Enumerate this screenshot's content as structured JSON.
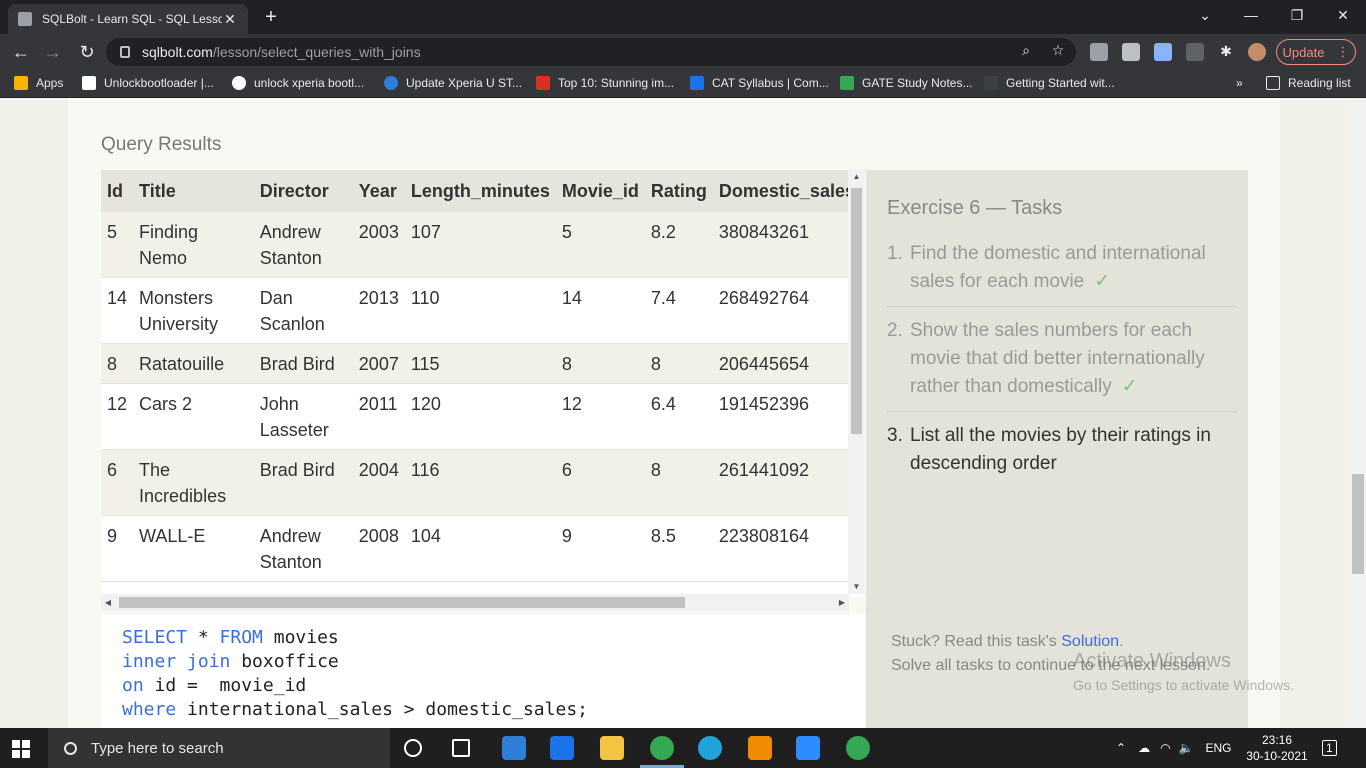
{
  "browser": {
    "tab_title": "SQLBolt - Learn SQL - SQL Lessor",
    "url_host": "sqlbolt.com",
    "url_path": "/lesson/select_queries_with_joins",
    "update_label": "Update",
    "bookmarks": [
      {
        "label": "Apps",
        "icon": "apps-grid-icon",
        "color": "#f4b400"
      },
      {
        "label": "Unlockbootloader |...",
        "icon": "s-logo-icon",
        "color": "#ffffff"
      },
      {
        "label": "unlock xperia bootl...",
        "icon": "globe-icon",
        "color": "#ffffff"
      },
      {
        "label": "Update Xperia U ST...",
        "icon": "e-logo-icon",
        "color": "#2f7ed8"
      },
      {
        "label": "Top 10: Stunning im...",
        "icon": "ibn-logo-icon",
        "color": "#d93025"
      },
      {
        "label": "CAT Syllabus | Com...",
        "icon": "c-logo-icon",
        "color": "#1a73e8"
      },
      {
        "label": "GATE Study Notes...",
        "icon": "leaf-icon",
        "color": "#34a853"
      },
      {
        "label": "Getting Started wit...",
        "icon": "page-icon",
        "color": "#3c4043"
      }
    ],
    "reading_list_label": "Reading list",
    "more_bookmarks": "»"
  },
  "page": {
    "query_results_title": "Query Results",
    "table": {
      "columns": [
        "Id",
        "Title",
        "Director",
        "Year",
        "Length_minutes",
        "Movie_id",
        "Rating",
        "Domestic_sales"
      ],
      "rows": [
        [
          "5",
          "Finding Nemo",
          "Andrew Stanton",
          "2003",
          "107",
          "5",
          "8.2",
          "380843261"
        ],
        [
          "14",
          "Monsters University",
          "Dan Scanlon",
          "2013",
          "110",
          "14",
          "7.4",
          "268492764"
        ],
        [
          "8",
          "Ratatouille",
          "Brad Bird",
          "2007",
          "115",
          "8",
          "8",
          "206445654"
        ],
        [
          "12",
          "Cars 2",
          "John Lasseter",
          "2011",
          "120",
          "12",
          "6.4",
          "191452396"
        ],
        [
          "6",
          "The Incredibles",
          "Brad Bird",
          "2004",
          "116",
          "6",
          "8",
          "261441092"
        ],
        [
          "9",
          "WALL-E",
          "Andrew Stanton",
          "2008",
          "104",
          "9",
          "8.5",
          "223808164"
        ]
      ]
    },
    "query_lines": [
      [
        {
          "t": "SELECT",
          "k": true
        },
        {
          "t": " * ",
          "k": false
        },
        {
          "t": "FROM",
          "k": true
        },
        {
          "t": " movies",
          "k": false
        }
      ],
      [
        {
          "t": "inner join",
          "k": true
        },
        {
          "t": " boxoffice",
          "k": false
        }
      ],
      [
        {
          "t": "on",
          "k": true
        },
        {
          "t": " id =  movie_id",
          "k": false
        }
      ],
      [
        {
          "t": "where",
          "k": true
        },
        {
          "t": " international_sales > domestic_sales;",
          "k": false
        }
      ]
    ],
    "exercise": {
      "title": "Exercise 6 — Tasks",
      "tasks": [
        {
          "num": "1.",
          "text": "Find the domestic and international sales for each movie",
          "done": true
        },
        {
          "num": "2.",
          "text": "Show the sales numbers for each movie that did better internationally rather than domestically",
          "done": true
        },
        {
          "num": "3.",
          "text": "List all the movies by their ratings in descending order",
          "done": false
        }
      ],
      "check_mark": "✓",
      "stuck_prefix": "Stuck? Read this task's ",
      "solution_link": "Solution",
      "stuck_suffix": ".",
      "continue_text": "Solve all tasks to continue to the next lesson."
    },
    "watermark": {
      "line1": "Activate Windows",
      "line2": "Go to Settings to activate Windows."
    }
  },
  "taskbar": {
    "search_placeholder": "Type here to search",
    "language": "ENG",
    "time": "23:16",
    "date": "30-10-2021",
    "notification_count": "1",
    "apps": [
      {
        "name": "cortana-icon",
        "color": "#ffffff"
      },
      {
        "name": "task-view-icon",
        "color": "#ffffff"
      },
      {
        "name": "store-icon",
        "color": "#2f7ed8"
      },
      {
        "name": "mail-icon",
        "color": "#1a73e8"
      },
      {
        "name": "file-explorer-icon",
        "color": "#f4c542"
      },
      {
        "name": "chrome-icon",
        "color": "#34a853"
      },
      {
        "name": "edge-icon",
        "color": "#1fa3d8"
      },
      {
        "name": "vlc-icon",
        "color": "#f08a00"
      },
      {
        "name": "zoom-icon",
        "color": "#2d8cff"
      },
      {
        "name": "chrome-profile-icon",
        "color": "#34a853"
      }
    ]
  }
}
